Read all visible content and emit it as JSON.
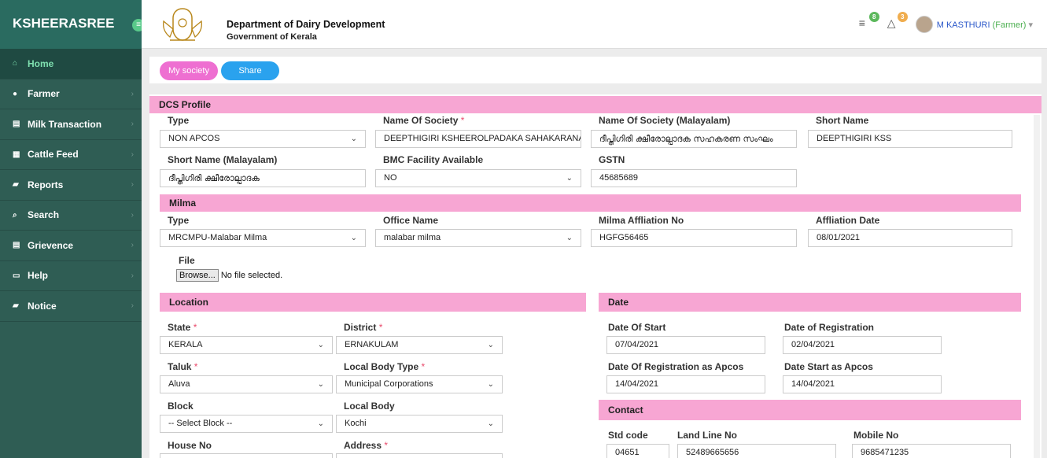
{
  "brand": "KSHEERASREE",
  "sidebar": {
    "items": [
      {
        "label": "Home",
        "icon": "home-icon",
        "active": true
      },
      {
        "label": "Farmer",
        "icon": "user-icon"
      },
      {
        "label": "Milk Transaction",
        "icon": "chart-icon"
      },
      {
        "label": "Cattle Feed",
        "icon": "cart-icon"
      },
      {
        "label": "Reports",
        "icon": "book-icon"
      },
      {
        "label": "Search",
        "icon": "search-icon"
      },
      {
        "label": "Grievence",
        "icon": "list-icon"
      },
      {
        "label": "Help",
        "icon": "monitor-icon"
      },
      {
        "label": "Notice",
        "icon": "book-icon"
      }
    ]
  },
  "header": {
    "department": "Department of Dairy Development",
    "government": "Government of Kerala",
    "messages_count": "8",
    "notifications_count": "3",
    "user_name": "M KASTHURI",
    "user_role": "(Farmer)"
  },
  "tabs": {
    "my_society": "My society",
    "share": "Share"
  },
  "profile": {
    "section_title": "DCS Profile",
    "type_label": "Type",
    "type_value": "NON APCOS",
    "society_label": "Name Of Society",
    "society_value": "DEEPTHIGIRI KSHEEROLPADAKA SAHAKARANA",
    "society_ml_label": "Name Of Society (Malayalam)",
    "society_ml_value": "ദീപ്തിഗിരി ക്ഷീരോല്പാദക സഹകരണ സംഘം",
    "short_label": "Short Name",
    "short_value": "DEEPTHIGIRI KSS",
    "short_ml_label": "Short Name (Malayalam)",
    "short_ml_value": "ദീപ്തിഗിരി ക്ഷീരോല്പാദക",
    "bmc_label": "BMC Facility Available",
    "bmc_value": "NO",
    "gstn_label": "GSTN",
    "gstn_value": "45685689"
  },
  "milma": {
    "section_title": "Milma",
    "type_label": "Type",
    "type_value": "MRCMPU-Malabar Milma",
    "office_label": "Office Name",
    "office_value": "malabar milma",
    "affno_label": "Milma Affliation No",
    "affno_value": "HGFG56465",
    "affdate_label": "Affliation Date",
    "affdate_value": "08/01/2021",
    "file_label": "File",
    "browse_label": "Browse...",
    "file_status": "No file selected."
  },
  "location": {
    "section_title": "Location",
    "state_label": "State",
    "state_value": "KERALA",
    "district_label": "District",
    "district_value": "ERNAKULAM",
    "taluk_label": "Taluk",
    "taluk_value": "Aluva",
    "lbtype_label": "Local Body Type",
    "lbtype_value": "Municipal Corporations",
    "block_label": "Block",
    "block_value": "-- Select Block --",
    "lb_label": "Local Body",
    "lb_value": "Kochi",
    "house_label": "House No",
    "address_label": "Address"
  },
  "date": {
    "section_title": "Date",
    "start_label": "Date Of Start",
    "start_value": "07/04/2021",
    "reg_label": "Date of Registration",
    "reg_value": "02/04/2021",
    "reg_apcos_label": "Date Of Registration as Apcos",
    "reg_apcos_value": "14/04/2021",
    "start_apcos_label": "Date Start as Apcos",
    "start_apcos_value": "14/04/2021"
  },
  "contact": {
    "section_title": "Contact",
    "std_label": "Std code",
    "std_value": "04651",
    "land_label": "Land Line No",
    "land_value": "52489665656",
    "mobile_label": "Mobile No",
    "mobile_value": "9685471235"
  }
}
